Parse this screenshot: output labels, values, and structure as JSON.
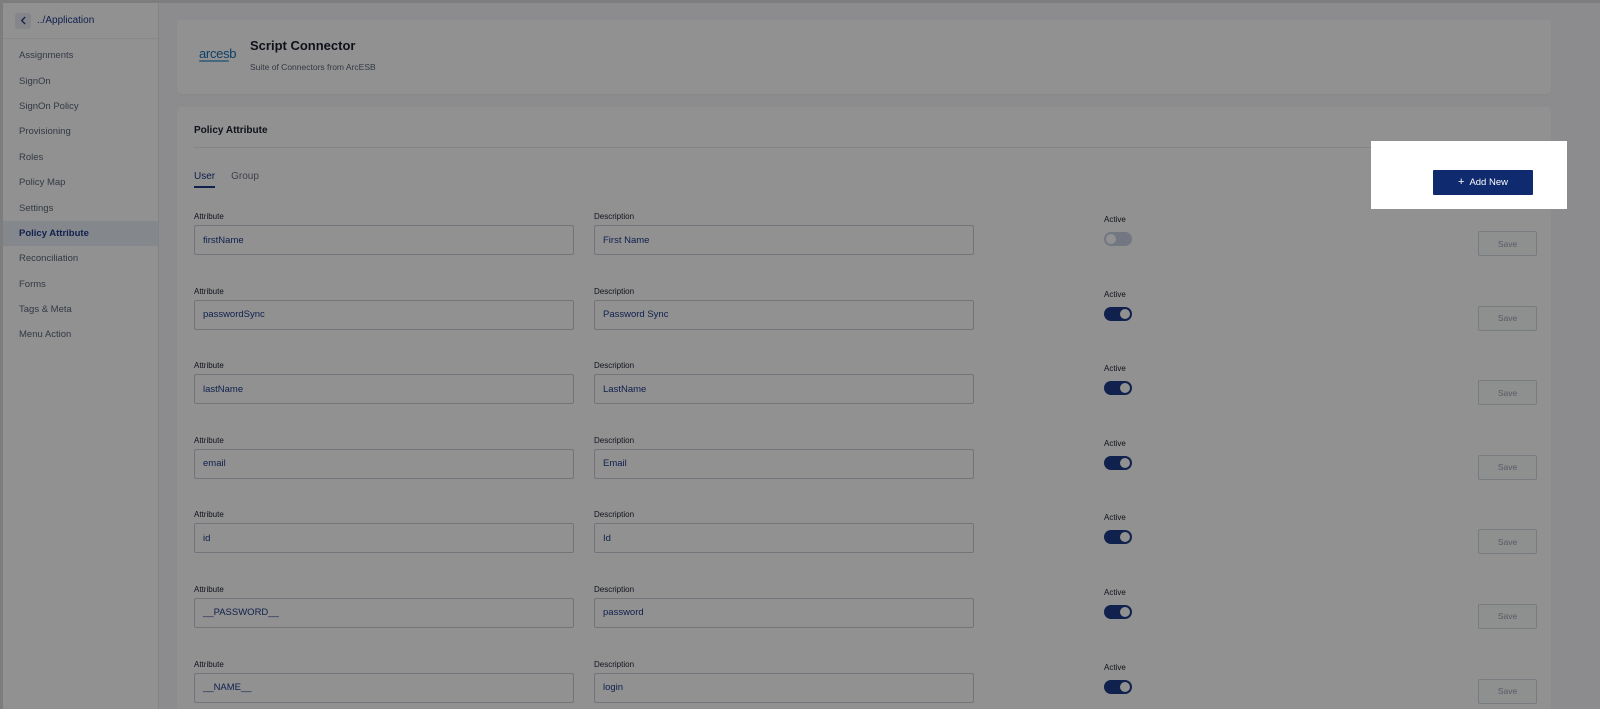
{
  "sidebar": {
    "back_label": "../Application",
    "items": [
      {
        "label": "Assignments",
        "active": false
      },
      {
        "label": "SignOn",
        "active": false
      },
      {
        "label": "SignOn Policy",
        "active": false
      },
      {
        "label": "Provisioning",
        "active": false
      },
      {
        "label": "Roles",
        "active": false
      },
      {
        "label": "Policy Map",
        "active": false
      },
      {
        "label": "Settings",
        "active": false
      },
      {
        "label": "Policy Attribute",
        "active": true
      },
      {
        "label": "Reconciliation",
        "active": false
      },
      {
        "label": "Forms",
        "active": false
      },
      {
        "label": "Tags & Meta",
        "active": false
      },
      {
        "label": "Menu Action",
        "active": false
      }
    ]
  },
  "header": {
    "logo_text": "arcesb",
    "title": "Script Connector",
    "subtitle": "Suite of Connectors from ArcESB"
  },
  "section": {
    "title": "Policy Attribute",
    "tabs": [
      {
        "label": "User",
        "active": true
      },
      {
        "label": "Group",
        "active": false
      }
    ],
    "add_new_label": "Add New",
    "field_labels": {
      "attribute": "Attribute",
      "description": "Description",
      "active": "Active",
      "save": "Save"
    },
    "rows": [
      {
        "attribute": "firstName",
        "description": "First Name",
        "active": false
      },
      {
        "attribute": "passwordSync",
        "description": "Password Sync",
        "active": true
      },
      {
        "attribute": "lastName",
        "description": "LastName",
        "active": true
      },
      {
        "attribute": "email",
        "description": "Email",
        "active": true
      },
      {
        "attribute": "id",
        "description": "Id",
        "active": true
      },
      {
        "attribute": "__PASSWORD__",
        "description": "password",
        "active": true
      },
      {
        "attribute": "__NAME__",
        "description": "login",
        "active": true
      }
    ]
  },
  "colors": {
    "accent": "#1e3a8a",
    "button_primary": "#0f2a6e",
    "overlay": "rgba(0,0,0,0.43)"
  }
}
